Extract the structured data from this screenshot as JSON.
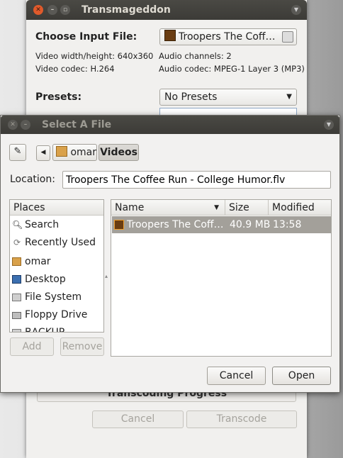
{
  "back_window": {
    "title": "Transmageddon",
    "choose_input_label": "Choose Input File:",
    "input_file": "Troopers The Coff…",
    "video_size": "Video width/height: 640x360",
    "video_codec": "Video codec: H.264",
    "audio_channels": "Audio channels: 2",
    "audio_codec": "Audio codec: MPEG-1 Layer 3 (MP3)",
    "presets_label": "Presets:",
    "presets_value": "No Presets",
    "progress_label": "Transcoding Progress",
    "cancel_label": "Cancel",
    "transcode_label": "Transcode"
  },
  "dialog": {
    "title": "Select A File",
    "path": [
      "omar",
      "Videos"
    ],
    "location_label": "Location:",
    "location_value": "Troopers The Coffee Run - College Humor.flv",
    "places_header": "Places",
    "places": [
      {
        "label": "Search",
        "icon": "search-icon"
      },
      {
        "label": "Recently Used",
        "icon": "recent-icon"
      },
      {
        "label": "omar",
        "icon": "home-folder-icon"
      },
      {
        "label": "Desktop",
        "icon": "desktop-icon"
      },
      {
        "label": "File System",
        "icon": "drive-icon"
      },
      {
        "label": "Floppy Drive",
        "icon": "floppy-icon"
      },
      {
        "label": "BACKUP",
        "icon": "drive-icon"
      }
    ],
    "columns": {
      "name": "Name",
      "size": "Size",
      "modified": "Modified"
    },
    "files": [
      {
        "name": "Troopers The Coff…",
        "size": "40.9 MB",
        "modified": "13:58"
      }
    ],
    "add_label": "Add",
    "remove_label": "Remove",
    "cancel_label": "Cancel",
    "open_label": "Open"
  }
}
